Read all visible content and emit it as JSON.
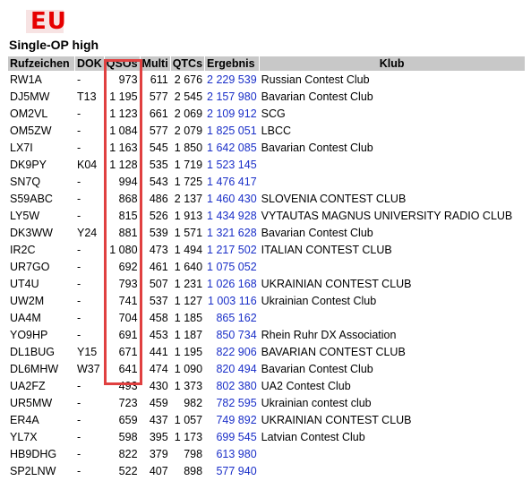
{
  "badge": "EU",
  "heading": "Single-OP high",
  "columns": [
    "Rufzeichen",
    "DOK",
    "QSOs",
    "Multi",
    "QTCs",
    "Ergebnis",
    "Klub"
  ],
  "colors": {
    "header_bg": "#c8c8c8",
    "result_link": "#1a2fc8",
    "highlight": "#e04040",
    "badge": "#e60000"
  },
  "rows": [
    [
      "RW1A",
      "-",
      "973",
      "611",
      "2 676",
      "2 229 539",
      "Russian Contest Club"
    ],
    [
      "DJ5MW",
      "T13",
      "1 195",
      "577",
      "2 545",
      "2 157 980",
      "Bavarian Contest Club"
    ],
    [
      "OM2VL",
      "-",
      "1 123",
      "661",
      "2 069",
      "2 109 912",
      "SCG"
    ],
    [
      "OM5ZW",
      "-",
      "1 084",
      "577",
      "2 079",
      "1 825 051",
      "LBCC"
    ],
    [
      "LX7I",
      "-",
      "1 163",
      "545",
      "1 850",
      "1 642 085",
      "Bavarian Contest Club"
    ],
    [
      "DK9PY",
      "K04",
      "1 128",
      "535",
      "1 719",
      "1 523 145",
      ""
    ],
    [
      "SN7Q",
      "-",
      "994",
      "543",
      "1 725",
      "1 476 417",
      ""
    ],
    [
      "S59ABC",
      "-",
      "868",
      "486",
      "2 137",
      "1 460 430",
      "SLOVENIA CONTEST CLUB"
    ],
    [
      "LY5W",
      "-",
      "815",
      "526",
      "1 913",
      "1 434 928",
      "VYTAUTAS MAGNUS UNIVERSITY RADIO CLUB"
    ],
    [
      "DK3WW",
      "Y24",
      "881",
      "539",
      "1 571",
      "1 321 628",
      "Bavarian Contest Club"
    ],
    [
      "IR2C",
      "-",
      "1 080",
      "473",
      "1 494",
      "1 217 502",
      "ITALIAN CONTEST CLUB"
    ],
    [
      "UR7GO",
      "-",
      "692",
      "461",
      "1 640",
      "1 075 052",
      ""
    ],
    [
      "UT4U",
      "-",
      "793",
      "507",
      "1 231",
      "1 026 168",
      "UKRAINIAN CONTEST CLUB"
    ],
    [
      "UW2M",
      "-",
      "741",
      "537",
      "1 127",
      "1 003 116",
      "Ukrainian Contest Club"
    ],
    [
      "UA4M",
      "-",
      "704",
      "458",
      "1 185",
      "865 162",
      ""
    ],
    [
      "YO9HP",
      "-",
      "691",
      "453",
      "1 187",
      "850 734",
      "Rhein Ruhr DX Association"
    ],
    [
      "DL1BUG",
      "Y15",
      "671",
      "441",
      "1 195",
      "822 906",
      "BAVARIAN CONTEST CLUB"
    ],
    [
      "DL6MHW",
      "W37",
      "641",
      "474",
      "1 090",
      "820 494",
      "Bavarian Contest Club"
    ],
    [
      "UA2FZ",
      "-",
      "493",
      "430",
      "1 373",
      "802 380",
      "UA2 Contest Club"
    ],
    [
      "UR5MW",
      "-",
      "723",
      "459",
      "982",
      "782 595",
      "Ukrainian contest club"
    ],
    [
      "ER4A",
      "-",
      "659",
      "437",
      "1 057",
      "749 892",
      "UKRAINIAN CONTEST CLUB"
    ],
    [
      "YL7X",
      "-",
      "598",
      "395",
      "1 173",
      "699 545",
      "Latvian Contest Club"
    ],
    [
      "HB9DHG",
      "-",
      "822",
      "379",
      "798",
      "613 980",
      ""
    ],
    [
      "SP2LNW",
      "-",
      "522",
      "407",
      "898",
      "577 940",
      ""
    ]
  ]
}
